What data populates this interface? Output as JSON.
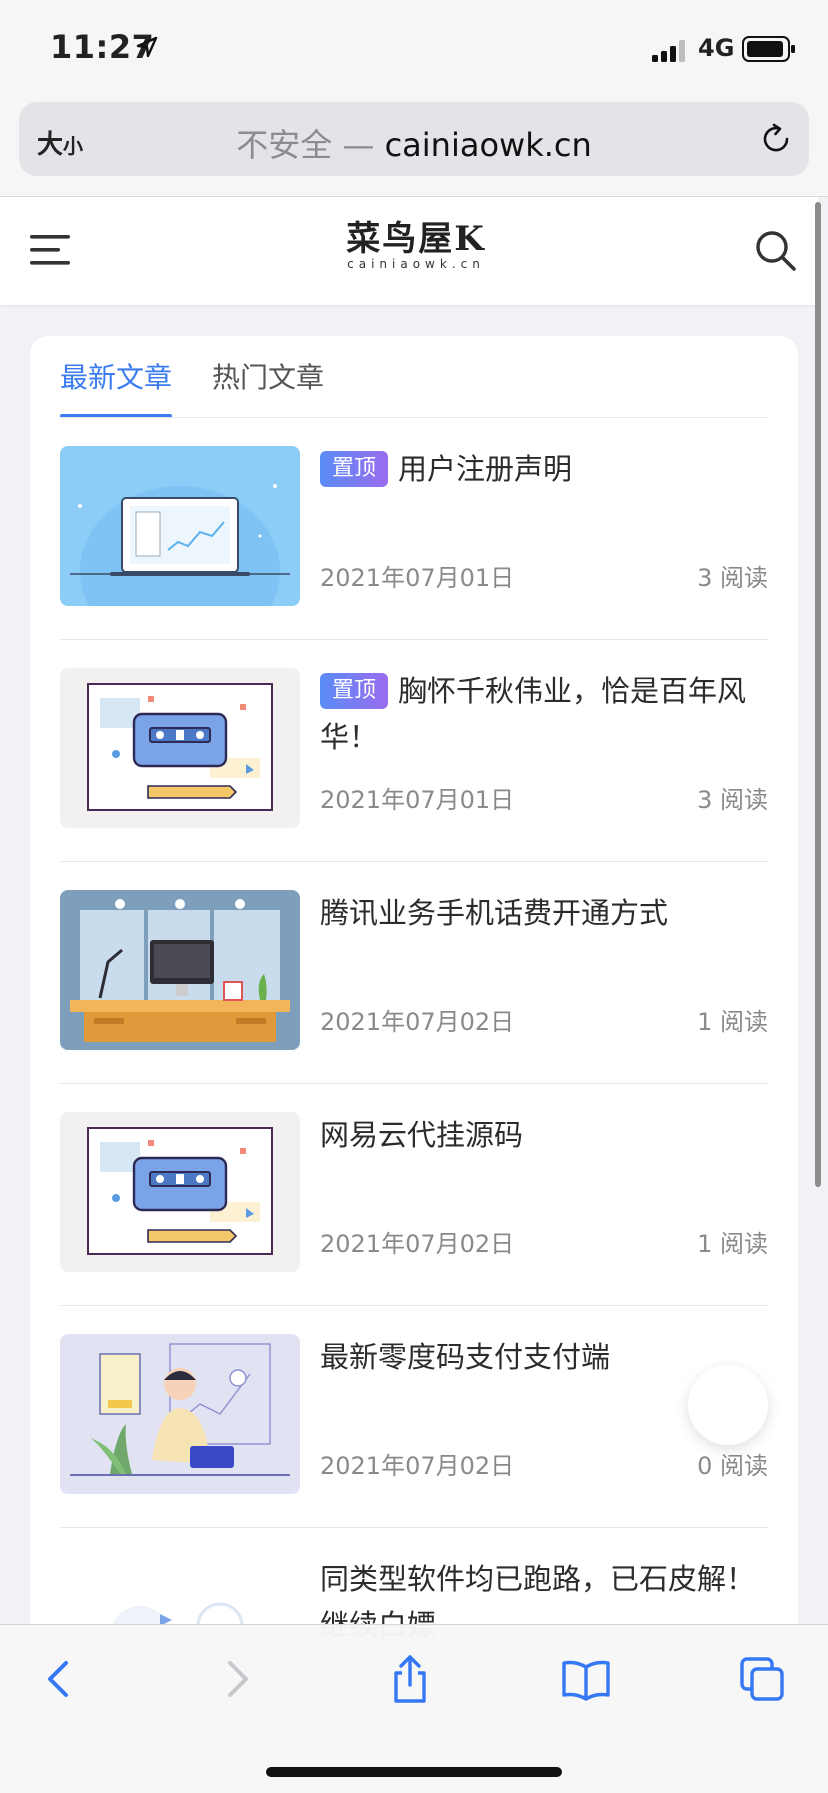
{
  "status": {
    "time": "11:27",
    "network": "4G"
  },
  "browser": {
    "text_size_label": "大",
    "text_size_small": "小",
    "insecure_label": "不安全 —",
    "domain": "cainiaowk.cn"
  },
  "site": {
    "logo_main": "菜鸟屋K",
    "logo_sub": "cainiaowk.cn"
  },
  "tabs": [
    {
      "label": "最新文章",
      "active": true
    },
    {
      "label": "热门文章",
      "active": false
    }
  ],
  "articles": [
    {
      "badge": "置顶",
      "title": "用户注册声明",
      "date": "2021年07月01日",
      "reads": "3 阅读"
    },
    {
      "badge": "置顶",
      "title": "胸怀千秋伟业，恰是百年风华！",
      "date": "2021年07月01日",
      "reads": "3 阅读"
    },
    {
      "title": "腾讯业务手机话费开通方式",
      "date": "2021年07月02日",
      "reads": "1 阅读"
    },
    {
      "title": "网易云代挂源码",
      "date": "2021年07月02日",
      "reads": "1 阅读"
    },
    {
      "title": "最新零度码支付支付端",
      "date": "2021年07月02日",
      "reads": "0 阅读"
    },
    {
      "title": "同类型软件均已跑路，已石皮解！继续白嫖"
    }
  ],
  "colors": {
    "accent": "#3b7cf0",
    "ios_blue": "#3478f6"
  },
  "icons": [
    "location-arrow-icon",
    "signal-icon",
    "battery-icon",
    "reload-icon",
    "menu-icon",
    "search-icon",
    "back-icon",
    "forward-icon",
    "share-icon",
    "bookmarks-icon",
    "tabs-icon"
  ]
}
